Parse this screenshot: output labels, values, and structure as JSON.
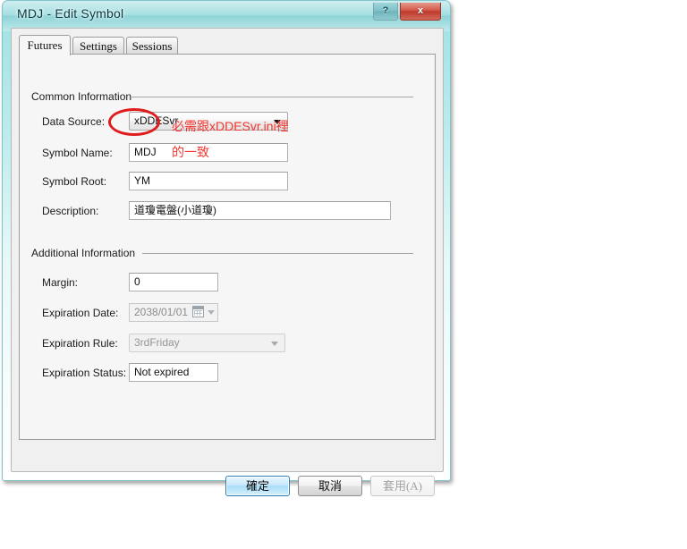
{
  "window": {
    "title": "MDJ - Edit Symbol",
    "help_button": "?",
    "close_button": "x",
    "help_icon": "question-mark-icon",
    "close_icon": "close-x-icon"
  },
  "tabs": [
    {
      "label": "Futures",
      "active": true
    },
    {
      "label": "Settings",
      "active": false
    },
    {
      "label": "Sessions",
      "active": false
    }
  ],
  "groups": {
    "common": {
      "label": "Common Information"
    },
    "additional": {
      "label": "Additional Information"
    }
  },
  "fields": {
    "data_source": {
      "label": "Data Source:",
      "value": "xDDESvr",
      "type": "combobox",
      "enabled": true
    },
    "symbol_name": {
      "label": "Symbol Name:",
      "value": "MDJ",
      "type": "text",
      "enabled": true
    },
    "symbol_root": {
      "label": "Symbol Root:",
      "value": "YM",
      "type": "text",
      "enabled": true
    },
    "description": {
      "label": "Description:",
      "value": "道瓊電盤(小道瓊)",
      "type": "text",
      "enabled": true
    },
    "margin": {
      "label": "Margin:",
      "value": "0",
      "type": "text",
      "enabled": true
    },
    "expiration_date": {
      "label": "Expiration Date:",
      "value": "2038/01/01",
      "type": "datepicker",
      "enabled": false
    },
    "expiration_rule": {
      "label": "Expiration Rule:",
      "value": "3rdFriday",
      "type": "combobox",
      "enabled": false
    },
    "expiration_status": {
      "label": "Expiration Status:",
      "value": "Not expired",
      "type": "text",
      "enabled": true
    }
  },
  "buttons": {
    "ok": {
      "label": "確定",
      "state": "default"
    },
    "cancel": {
      "label": "取消",
      "state": "normal"
    },
    "apply": {
      "label": "套用(A)",
      "state": "disabled"
    }
  },
  "annotations": {
    "color": "#f4352f",
    "line1": "必需跟xDDESvr.ini裡",
    "line2": "的一致",
    "ellipse_target": "symbol-name-input"
  }
}
